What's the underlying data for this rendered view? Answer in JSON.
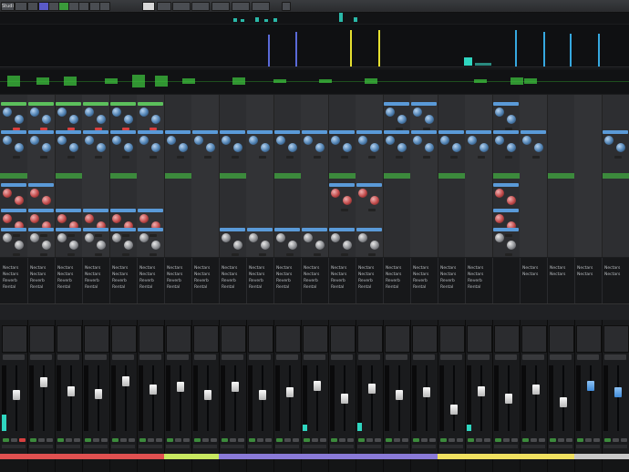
{
  "toolbar": {
    "buttons": [
      {
        "label": "Studio",
        "style": "plain"
      },
      {
        "label": "",
        "style": "plain"
      },
      {
        "label": "",
        "style": "plain"
      },
      {
        "label": "",
        "style": "blue"
      },
      {
        "label": "",
        "style": "plain"
      },
      {
        "label": "",
        "style": "green"
      },
      {
        "label": "",
        "style": "plain"
      },
      {
        "label": "",
        "style": "plain"
      },
      {
        "label": "",
        "style": "plain"
      },
      {
        "label": "",
        "style": "plain"
      },
      {
        "label": "",
        "style": "white"
      },
      {
        "label": "",
        "style": "plain"
      },
      {
        "label": "",
        "style": "plain"
      },
      {
        "label": "",
        "style": "plain"
      },
      {
        "label": "",
        "style": "plain"
      },
      {
        "label": "",
        "style": "plain"
      },
      {
        "label": "",
        "style": "plain"
      }
    ]
  },
  "colors": {
    "accent_blue": "#4d7fb0",
    "accent_red": "#c04848",
    "plugin_green": "#3c8a3c",
    "meter_teal": "#2fd6c0",
    "scope_yellow": "#e6e030",
    "scope_cyan": "#36a8e0"
  },
  "rack": {
    "knob_rows": [
      {
        "label": "row-1",
        "type": "blue"
      },
      {
        "label": "row-2",
        "type": "blue"
      },
      {
        "label": "row-3",
        "type": "red"
      },
      {
        "label": "row-4",
        "type": "red"
      },
      {
        "label": "row-5",
        "type": "grey"
      }
    ]
  },
  "slots": {
    "lines": [
      "Nectars",
      "Nectars",
      "Reverb",
      "Rental"
    ]
  },
  "mixer": {
    "channels": [
      {
        "name": "",
        "color": "#e05050",
        "fader": 0.55,
        "meter": 0.25,
        "cap": "white"
      },
      {
        "name": "",
        "color": "#e05050",
        "fader": 0.78,
        "meter": 0.0,
        "cap": "white"
      },
      {
        "name": "",
        "color": "#e05050",
        "fader": 0.62,
        "meter": 0.0,
        "cap": "white"
      },
      {
        "name": "",
        "color": "#e05050",
        "fader": 0.58,
        "meter": 0.0,
        "cap": "white"
      },
      {
        "name": "",
        "color": "#e05050",
        "fader": 0.8,
        "meter": 0.0,
        "cap": "white"
      },
      {
        "name": "",
        "color": "#e05050",
        "fader": 0.66,
        "meter": 0.0,
        "cap": "white"
      },
      {
        "name": "",
        "color": "#c8e860",
        "fader": 0.7,
        "meter": 0.0,
        "cap": "white"
      },
      {
        "name": "",
        "color": "#c8e860",
        "fader": 0.55,
        "meter": 0.0,
        "cap": "white"
      },
      {
        "name": "",
        "color": "#8a7ad8",
        "fader": 0.7,
        "meter": 0.0,
        "cap": "white"
      },
      {
        "name": "",
        "color": "#8a7ad8",
        "fader": 0.55,
        "meter": 0.0,
        "cap": "white"
      },
      {
        "name": "",
        "color": "#8a7ad8",
        "fader": 0.6,
        "meter": 0.0,
        "cap": "white"
      },
      {
        "name": "",
        "color": "#8a7ad8",
        "fader": 0.72,
        "meter": 0.1,
        "cap": "white"
      },
      {
        "name": "",
        "color": "#8a7ad8",
        "fader": 0.5,
        "meter": 0.0,
        "cap": "white"
      },
      {
        "name": "",
        "color": "#8a7ad8",
        "fader": 0.68,
        "meter": 0.12,
        "cap": "white"
      },
      {
        "name": "",
        "color": "#8a7ad8",
        "fader": 0.55,
        "meter": 0.0,
        "cap": "white"
      },
      {
        "name": "",
        "color": "#8a7ad8",
        "fader": 0.6,
        "meter": 0.0,
        "cap": "white"
      },
      {
        "name": "",
        "color": "#f0e060",
        "fader": 0.3,
        "meter": 0.0,
        "cap": "white"
      },
      {
        "name": "",
        "color": "#f0e060",
        "fader": 0.62,
        "meter": 0.1,
        "cap": "white"
      },
      {
        "name": "",
        "color": "#f0e060",
        "fader": 0.5,
        "meter": 0.0,
        "cap": "white"
      },
      {
        "name": "",
        "color": "#f0e060",
        "fader": 0.66,
        "meter": 0.0,
        "cap": "white"
      },
      {
        "name": "",
        "color": "#f0e060",
        "fader": 0.42,
        "meter": 0.0,
        "cap": "white"
      },
      {
        "name": "",
        "color": "#c8c8c8",
        "fader": 0.72,
        "meter": 0.0,
        "cap": "blue"
      },
      {
        "name": "",
        "color": "#c8c8c8",
        "fader": 0.6,
        "meter": 0.0,
        "cap": "blue"
      },
      {
        "name": "",
        "color": "#38a0e0",
        "fader": 0.4,
        "meter": 0.0,
        "cap": "white"
      },
      {
        "name": "",
        "color": "#38a0e0",
        "fader": 0.55,
        "meter": 0.0,
        "cap": "white"
      },
      {
        "name": "",
        "color": "#38a0e0",
        "fader": 0.62,
        "meter": 0.0,
        "cap": "white"
      },
      {
        "name": "",
        "color": "#38a0e0",
        "fader": 0.48,
        "meter": 0.0,
        "cap": "white"
      },
      {
        "name": "",
        "color": "#38a0e0",
        "fader": 0.35,
        "meter": 0.0,
        "cap": "white"
      },
      {
        "name": "",
        "color": "#38a0e0",
        "fader": 0.58,
        "meter": 0.0,
        "cap": "white"
      },
      {
        "name": "",
        "color": "#38a0e0",
        "fader": 0.7,
        "meter": 0.0,
        "cap": "white"
      }
    ]
  }
}
